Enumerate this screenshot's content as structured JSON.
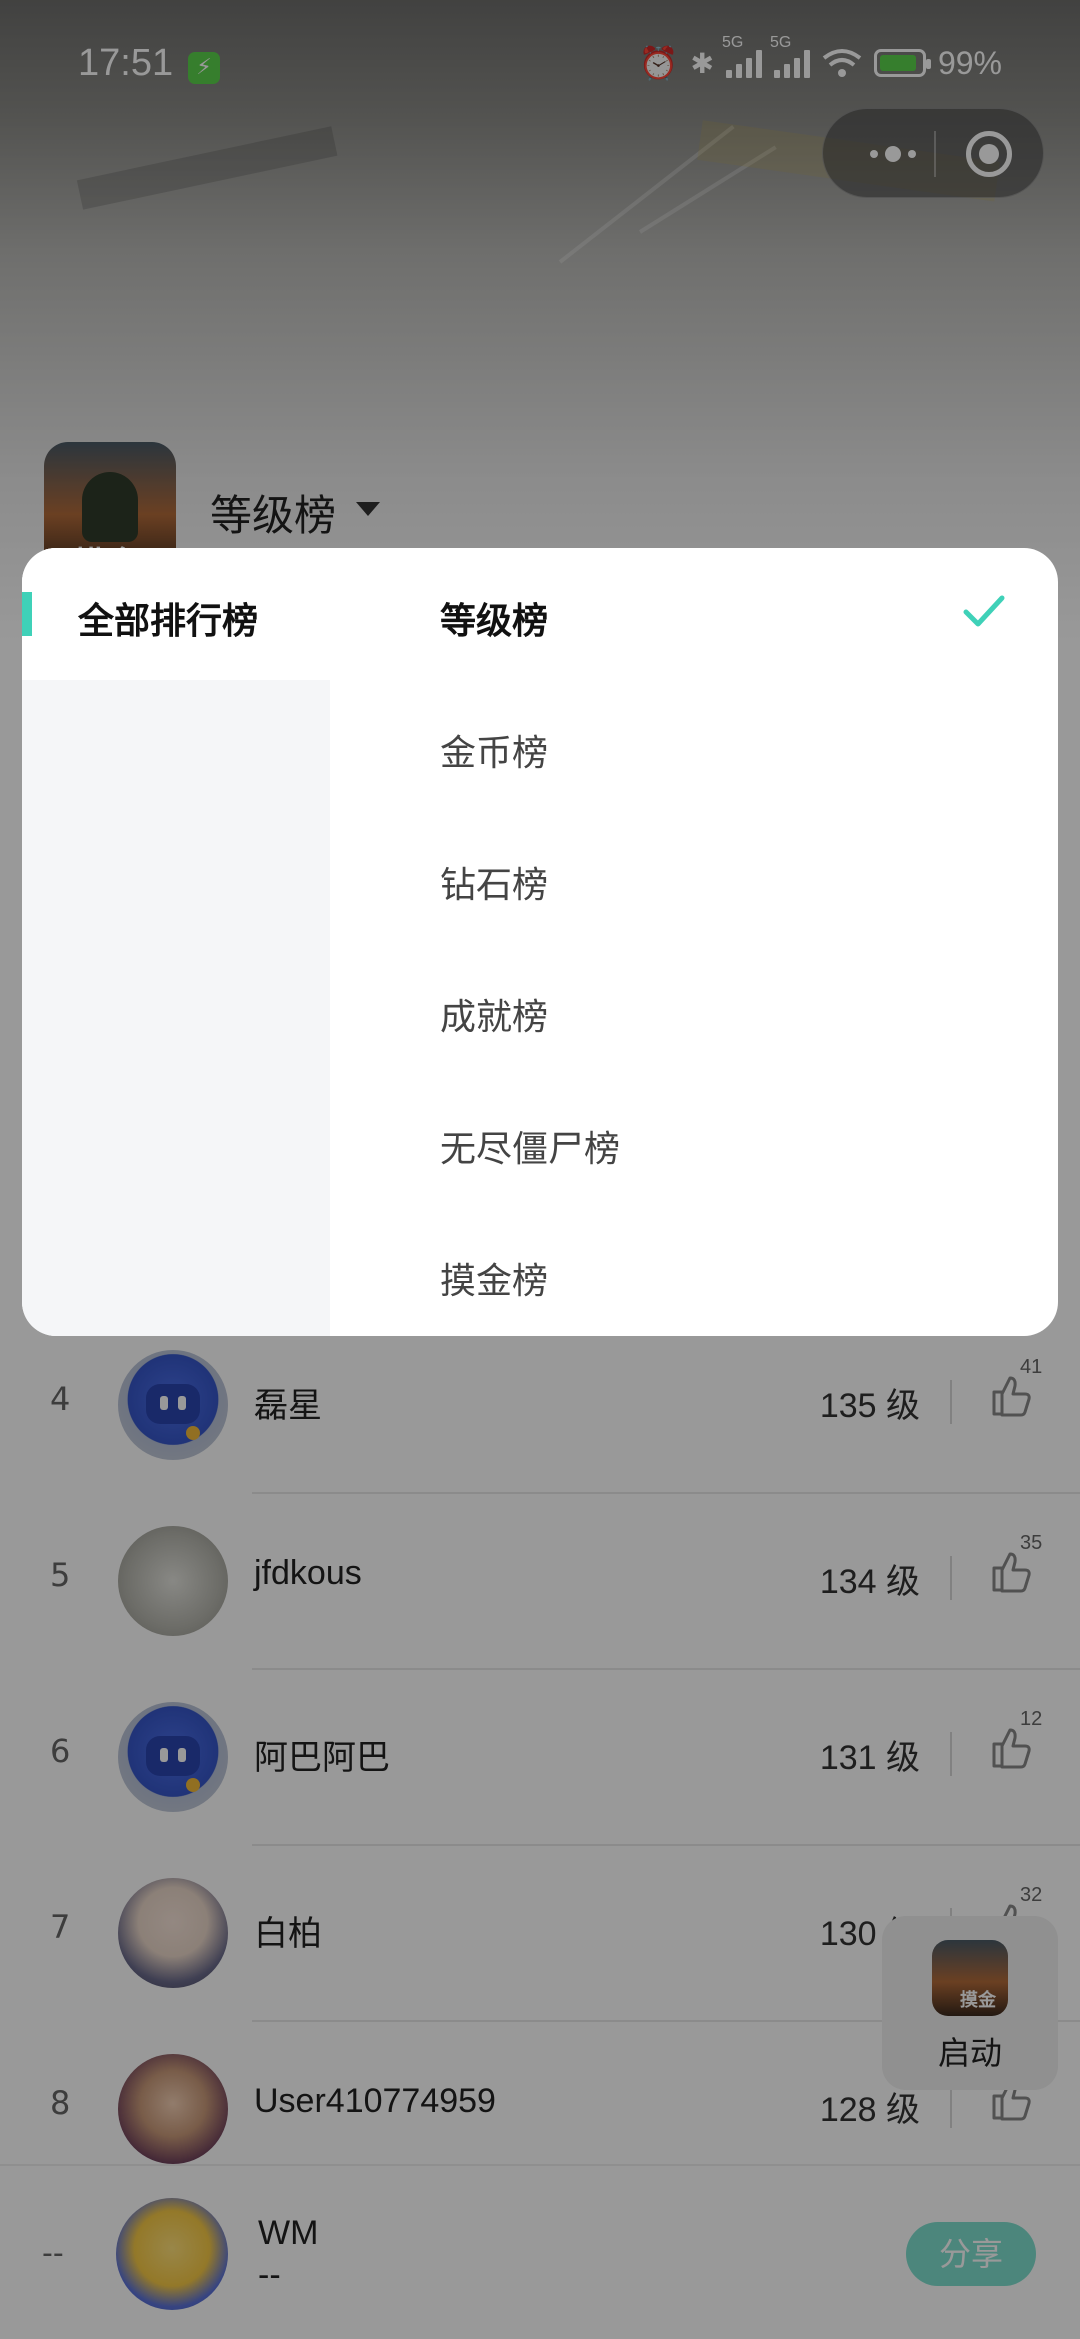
{
  "status_bar": {
    "time": "17:51",
    "network_1": "5G",
    "network_2": "5G",
    "battery": "99%"
  },
  "header": {
    "game_icon_text": "摸金",
    "board_title": "等级榜"
  },
  "ranking": [
    {
      "rank": "4",
      "name": "磊星",
      "level": "135 级",
      "likes": "41",
      "avatar": "robot"
    },
    {
      "rank": "5",
      "name": "jfdkous",
      "level": "134 级",
      "likes": "35",
      "avatar": "sketch"
    },
    {
      "rank": "6",
      "name": "阿巴阿巴",
      "level": "131 级",
      "likes": "12",
      "avatar": "robot"
    },
    {
      "rank": "7",
      "name": "白柏",
      "level": "130 级",
      "likes": "32",
      "avatar": "anime1"
    },
    {
      "rank": "8",
      "name": "User410774959",
      "level": "128 级",
      "likes": "",
      "avatar": "anime2"
    }
  ],
  "launch": {
    "icon_text": "摸金",
    "label": "启动"
  },
  "me": {
    "rank": "--",
    "name": "WM",
    "level": "--",
    "share_label": "分享"
  },
  "dropdown": {
    "category": "全部排行榜",
    "options": [
      {
        "label": "等级榜",
        "selected": true
      },
      {
        "label": "金币榜",
        "selected": false
      },
      {
        "label": "钻石榜",
        "selected": false
      },
      {
        "label": "成就榜",
        "selected": false
      },
      {
        "label": "无尽僵尸榜",
        "selected": false
      },
      {
        "label": "摸金榜",
        "selected": false
      }
    ]
  },
  "colors": {
    "accent": "#3fd1b8",
    "share_button": "#7fe0cf",
    "charge": "#5bd24b"
  },
  "icons": [
    "alarm-icon",
    "bluetooth-icon",
    "signal-icon",
    "wifi-icon",
    "battery-icon",
    "more-dots-icon",
    "target-icon",
    "thumbs-up-icon",
    "check-icon",
    "caret-down-icon"
  ]
}
